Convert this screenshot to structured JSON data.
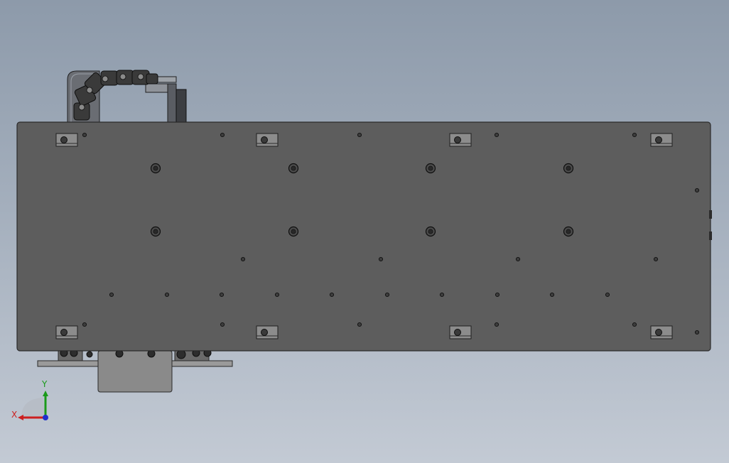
{
  "viewport": {
    "background_top": "#8d9aaa",
    "background_bottom": "#c3cad4",
    "plate_color": "#5d5d5d",
    "plate_edge": "#2b2b2b",
    "carriage_color": "#8a8a8a"
  },
  "model": {
    "part": "linear-module-plate",
    "view": "top",
    "tslot_nut_count": 8,
    "counterbore_count": 8,
    "small_hole_count": 26,
    "cable_chain_links": 7
  },
  "triad": {
    "x_label": "X",
    "y_label": "Y",
    "x_color": "#cc1f1f",
    "y_color": "#1a9a1a",
    "z_color": "#1f2fcc"
  }
}
